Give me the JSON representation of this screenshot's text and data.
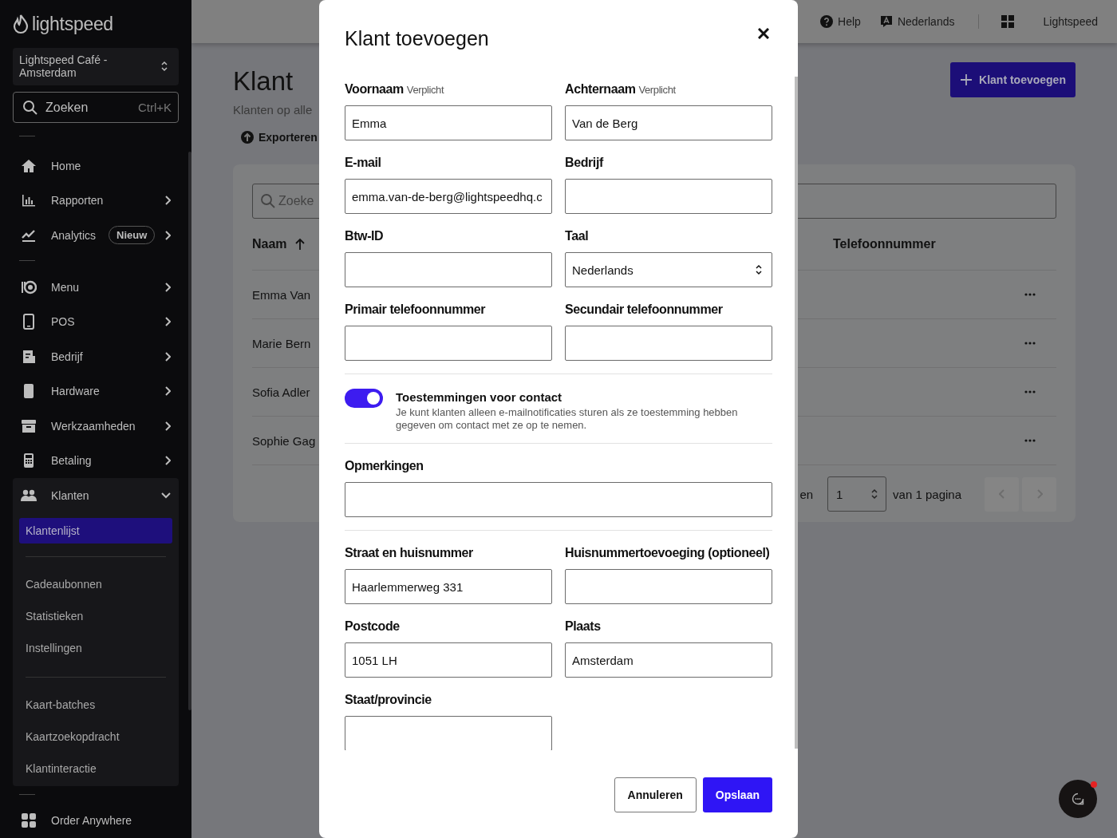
{
  "sidebar": {
    "logo": "lightspeed",
    "location": "Lightspeed Café - Amsterdam",
    "search": {
      "placeholder": "Zoeken",
      "shortcut": "Ctrl+K"
    },
    "nav_groups": [
      [
        {
          "label": "Home",
          "kind": "home"
        },
        {
          "label": "Rapporten",
          "kind": "chart",
          "expanded": false
        },
        {
          "label": "Analytics",
          "kind": "trend",
          "badge": "Nieuw",
          "expanded": false
        }
      ],
      [
        {
          "label": "Menu",
          "kind": "dish",
          "expanded": false
        },
        {
          "label": "POS",
          "kind": "tablet",
          "expanded": false
        },
        {
          "label": "Bedrijf",
          "kind": "business",
          "expanded": false
        },
        {
          "label": "Hardware",
          "kind": "device",
          "expanded": false
        },
        {
          "label": "Werkzaamheden",
          "kind": "box",
          "expanded": false
        },
        {
          "label": "Betaling",
          "kind": "terminal",
          "expanded": false
        },
        {
          "label": "Klanten",
          "kind": "people",
          "expanded": true,
          "child_groups": [
            [
              {
                "label": "Klantenlijst",
                "selected": true
              }
            ],
            [
              {
                "label": "Cadeaubonnen",
                "selected": false
              },
              {
                "label": "Statistieken",
                "selected": false
              },
              {
                "label": "Instellingen",
                "selected": false
              }
            ],
            [
              {
                "label": "Kaart-batches",
                "selected": false
              },
              {
                "label": "Kaartzoekopdracht",
                "selected": false
              },
              {
                "label": "Klantinteractie",
                "selected": false
              }
            ]
          ]
        }
      ],
      [
        {
          "label": "Order Anywhere",
          "kind": "grid"
        }
      ]
    ]
  },
  "top_bar": {
    "help": "Help",
    "language": "Nederlands",
    "account": "Lightspeed"
  },
  "page": {
    "title": "Klant",
    "subtitle": "Klanten op alle",
    "export": "Exporteren",
    "add_button": "Klant toevoegen",
    "search": {
      "placeholder": "Zoeke"
    },
    "columns": [
      {
        "label": "Naam",
        "sorted": true
      },
      {
        "label": "Telefoonnummer",
        "sorted": false
      }
    ],
    "rows": [
      {
        "name": "Emma Van"
      },
      {
        "name": "Marie Bern"
      },
      {
        "name": "Sofia Adler"
      },
      {
        "name": "Sophie Gag"
      }
    ],
    "pagination": {
      "label": "en",
      "page": "1",
      "total": "van 1 pagina",
      "prev_disabled": true,
      "next_disabled": true
    }
  },
  "modal": {
    "title": "Klant toevoegen",
    "sections": [
      {
        "kind": "fields",
        "rows": [
          [
            {
              "kind": "text",
              "label": "Voornaam",
              "note": "Verplicht",
              "value": "Emma"
            },
            {
              "kind": "text",
              "label": "Achternaam",
              "note": "Verplicht",
              "value": "Van de Berg"
            }
          ],
          [
            {
              "kind": "text",
              "label": "E-mail",
              "value": "emma.van-de-berg@lightspeedhq.c"
            },
            {
              "kind": "text",
              "label": "Bedrijf"
            }
          ],
          [
            {
              "kind": "text",
              "label": "Btw-ID"
            },
            {
              "kind": "select",
              "label": "Taal",
              "value": "Nederlands"
            }
          ],
          [
            {
              "kind": "text",
              "label": "Primair telefoonnummer"
            },
            {
              "kind": "text",
              "label": "Secundair telefoonnummer"
            }
          ]
        ]
      },
      {
        "kind": "toggle",
        "on": true,
        "title": "Toestemmingen voor contact",
        "description": "Je kunt klanten alleen e-mailnotificaties sturen als ze toestemming hebben gegeven om contact met ze op te nemen."
      },
      {
        "kind": "fields",
        "rows": [
          [
            {
              "kind": "wide",
              "label": "Opmerkingen"
            }
          ]
        ]
      },
      {
        "kind": "fields",
        "rows": [
          [
            {
              "kind": "text",
              "label": "Straat en huisnummer",
              "value": "Haarlemmerweg 331"
            },
            {
              "kind": "text",
              "label": "Huisnummertoevoeging (optioneel)"
            }
          ],
          [
            {
              "kind": "text",
              "label": "Postcode",
              "value": "1051 LH"
            },
            {
              "kind": "text",
              "label": "Plaats",
              "value": "Amsterdam"
            }
          ],
          [
            {
              "kind": "text",
              "label": "Staat/provincie"
            }
          ]
        ]
      }
    ],
    "buttons": [
      {
        "label": "Annuleren",
        "kind": "secondary"
      },
      {
        "label": "Opslaan",
        "kind": "primary"
      }
    ]
  },
  "chat": {
    "unread": true
  }
}
